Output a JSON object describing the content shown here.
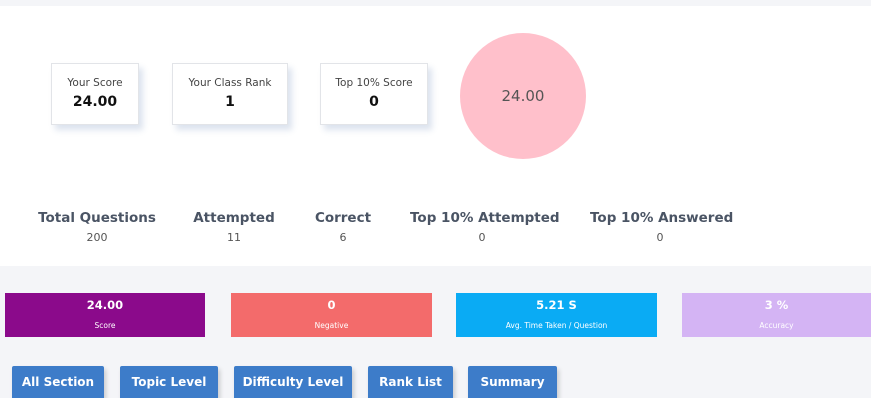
{
  "score_cards": [
    {
      "label": "Your Score",
      "value": "24.00"
    },
    {
      "label": "Your Class Rank",
      "value": "1"
    },
    {
      "label": "Top 10% Score",
      "value": "0"
    }
  ],
  "score_circle": {
    "value": "24.00",
    "color": "#ffc0cb"
  },
  "stats": [
    {
      "label": "Total Questions",
      "value": "200"
    },
    {
      "label": "Attempted",
      "value": "11"
    },
    {
      "label": "Correct",
      "value": "6"
    },
    {
      "label": "Top 10% Attempted",
      "value": "0"
    },
    {
      "label": "Top 10% Answered",
      "value": "0"
    }
  ],
  "metrics": [
    {
      "value": "24.00",
      "label": "Score",
      "color": "#8b0a8b"
    },
    {
      "value": "0",
      "label": "Negative",
      "color": "#f36b6b"
    },
    {
      "value": "5.21 S",
      "label": "Avg. Time Taken / Question",
      "color": "#0aabf4"
    },
    {
      "value": "3 %",
      "label": "Accuracy",
      "color": "#d4b4f4"
    }
  ],
  "tabs": [
    {
      "label": "All Section"
    },
    {
      "label": "Topic Level"
    },
    {
      "label": "Difficulty Level"
    },
    {
      "label": "Rank List"
    },
    {
      "label": "Summary"
    }
  ]
}
